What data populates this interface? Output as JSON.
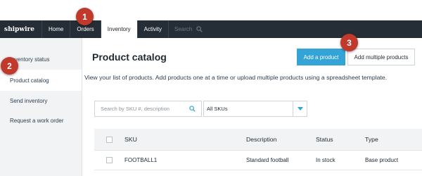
{
  "navbar": {
    "logo": "shipwire",
    "items": [
      {
        "label": "Home"
      },
      {
        "label": "Orders"
      },
      {
        "label": "Inventory",
        "active": true
      },
      {
        "label": "Activity"
      }
    ],
    "search_placeholder": "Search"
  },
  "sidebar": {
    "items": [
      {
        "label": "Inventory status"
      },
      {
        "label": "Product catalog",
        "active": true
      },
      {
        "label": "Send inventory"
      },
      {
        "label": "Request a work order"
      }
    ]
  },
  "main": {
    "title": "Product catalog",
    "add_product_label": "Add a product",
    "add_multiple_label": "Add multiple products",
    "description": "View your list of products. Add products one at a time or upload multiple products using a spreadsheet template.",
    "search_placeholder": "Search by SKU #, description",
    "sku_filter": "All SKUs"
  },
  "table": {
    "headers": [
      "SKU",
      "Description",
      "Status",
      "Type"
    ],
    "rows": [
      {
        "sku": "FOOTBALL1",
        "description": "Standard football",
        "status": "In stock",
        "type": "Base product"
      }
    ]
  },
  "callouts": [
    "1",
    "2",
    "3"
  ],
  "colors": {
    "navbar_bg": "#252e36",
    "primary_button": "#34a3d6",
    "callout": "#c0392b",
    "sidebar_bg": "#f1f3f4"
  }
}
